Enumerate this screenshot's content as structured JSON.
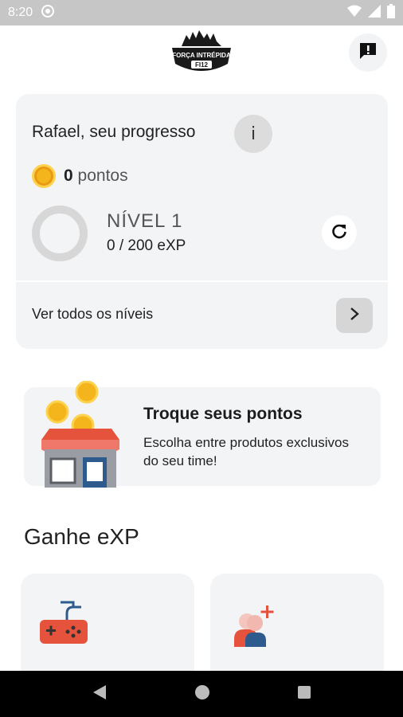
{
  "status_bar": {
    "time": "8:20"
  },
  "logo": {
    "lines": [
      "FORÇA INTRÉPIDA",
      "FI12"
    ]
  },
  "progress": {
    "title": "Rafael, seu progresso",
    "info_label": "i",
    "points_value": "0",
    "points_unit": "pontos",
    "level_name": "NÍVEL 1",
    "level_exp": "0 / 200 eXP",
    "level_progress_fraction": 0,
    "view_all_label": "Ver todos os níveis"
  },
  "exchange": {
    "title": "Troque seus pontos",
    "description": "Escolha entre produtos exclusivos do seu time!"
  },
  "earn": {
    "title": "Ganhe eXP",
    "cards": [
      {
        "icon": "gamepad-icon"
      },
      {
        "icon": "invite-friends-icon"
      }
    ]
  },
  "colors": {
    "card_bg": "#f3f4f6",
    "coin": "#f3b51b",
    "accent_red": "#e5533d",
    "accent_blue": "#2e5b8e"
  }
}
